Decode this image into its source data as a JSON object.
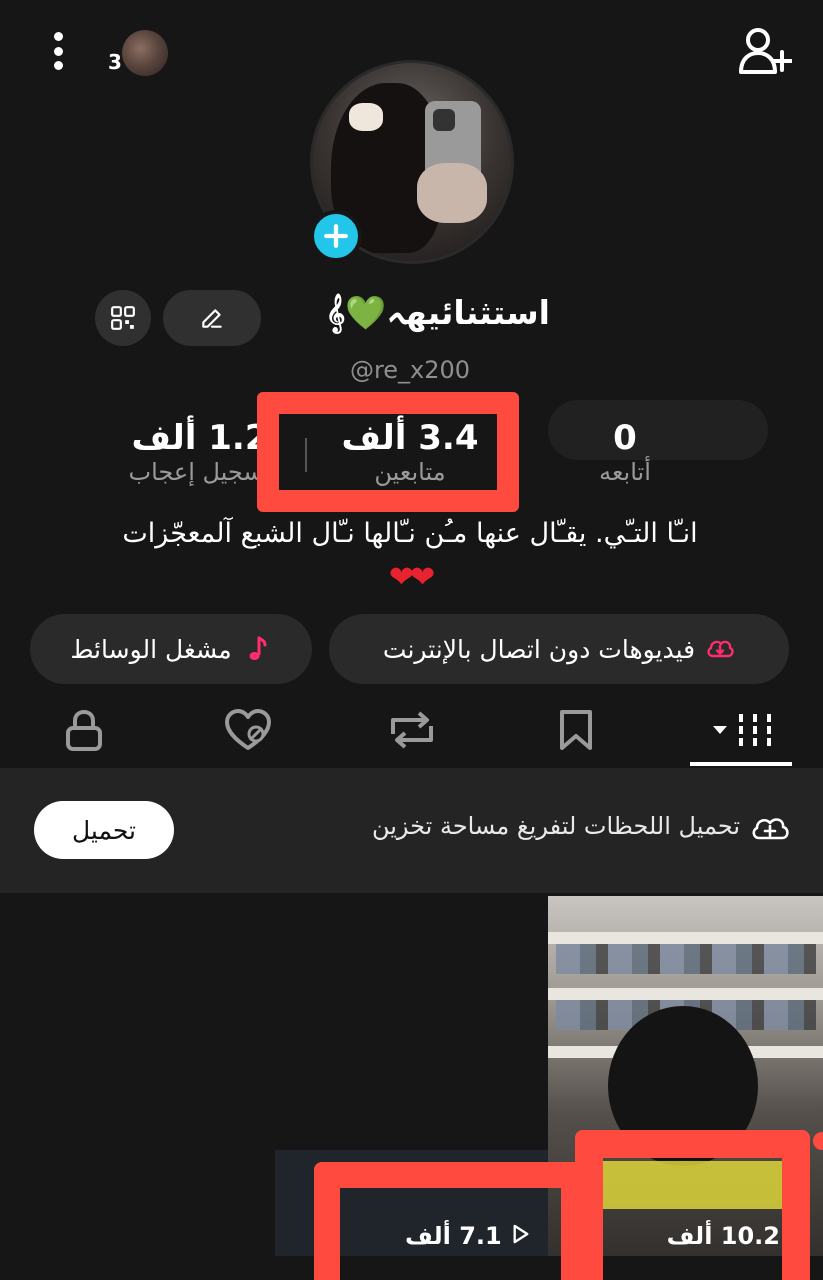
{
  "top_bar": {
    "notification_count": "3"
  },
  "profile": {
    "display_name": "استثنائيهہ💚𝄞",
    "username": "@re_x200",
    "bio": "انـّا التـّي. يقـّال عنها مـُن نـّالها نـّال الشبع آلمعجّزات",
    "bio_emoji": "❤❤"
  },
  "stats": {
    "likes": {
      "value": "1.2 ألف",
      "label": "تسجيل إعجاب"
    },
    "followers": {
      "value": "3.4 ألف",
      "label": "متابعين"
    },
    "following": {
      "value": "0",
      "label": "أتابعه"
    }
  },
  "pills": {
    "offline_videos": "فيديوهات دون اتصال بالإنترنت",
    "media_player": "مشغل الوسائط"
  },
  "tabs": [
    "posts-grid",
    "saved",
    "reposts",
    "liked",
    "private"
  ],
  "banner": {
    "text": "تحميل اللحظات لتفريغ مساحة تخزين",
    "button_label": "تحميل"
  },
  "videos": [
    {
      "views": "10.2 ألف"
    },
    {
      "views": "7.1 ألف"
    }
  ],
  "colors": {
    "background": "#161616",
    "accent_blue": "#23c5e8",
    "highlight_red": "#ff4a40",
    "music_pink": "#ff2d6f"
  }
}
